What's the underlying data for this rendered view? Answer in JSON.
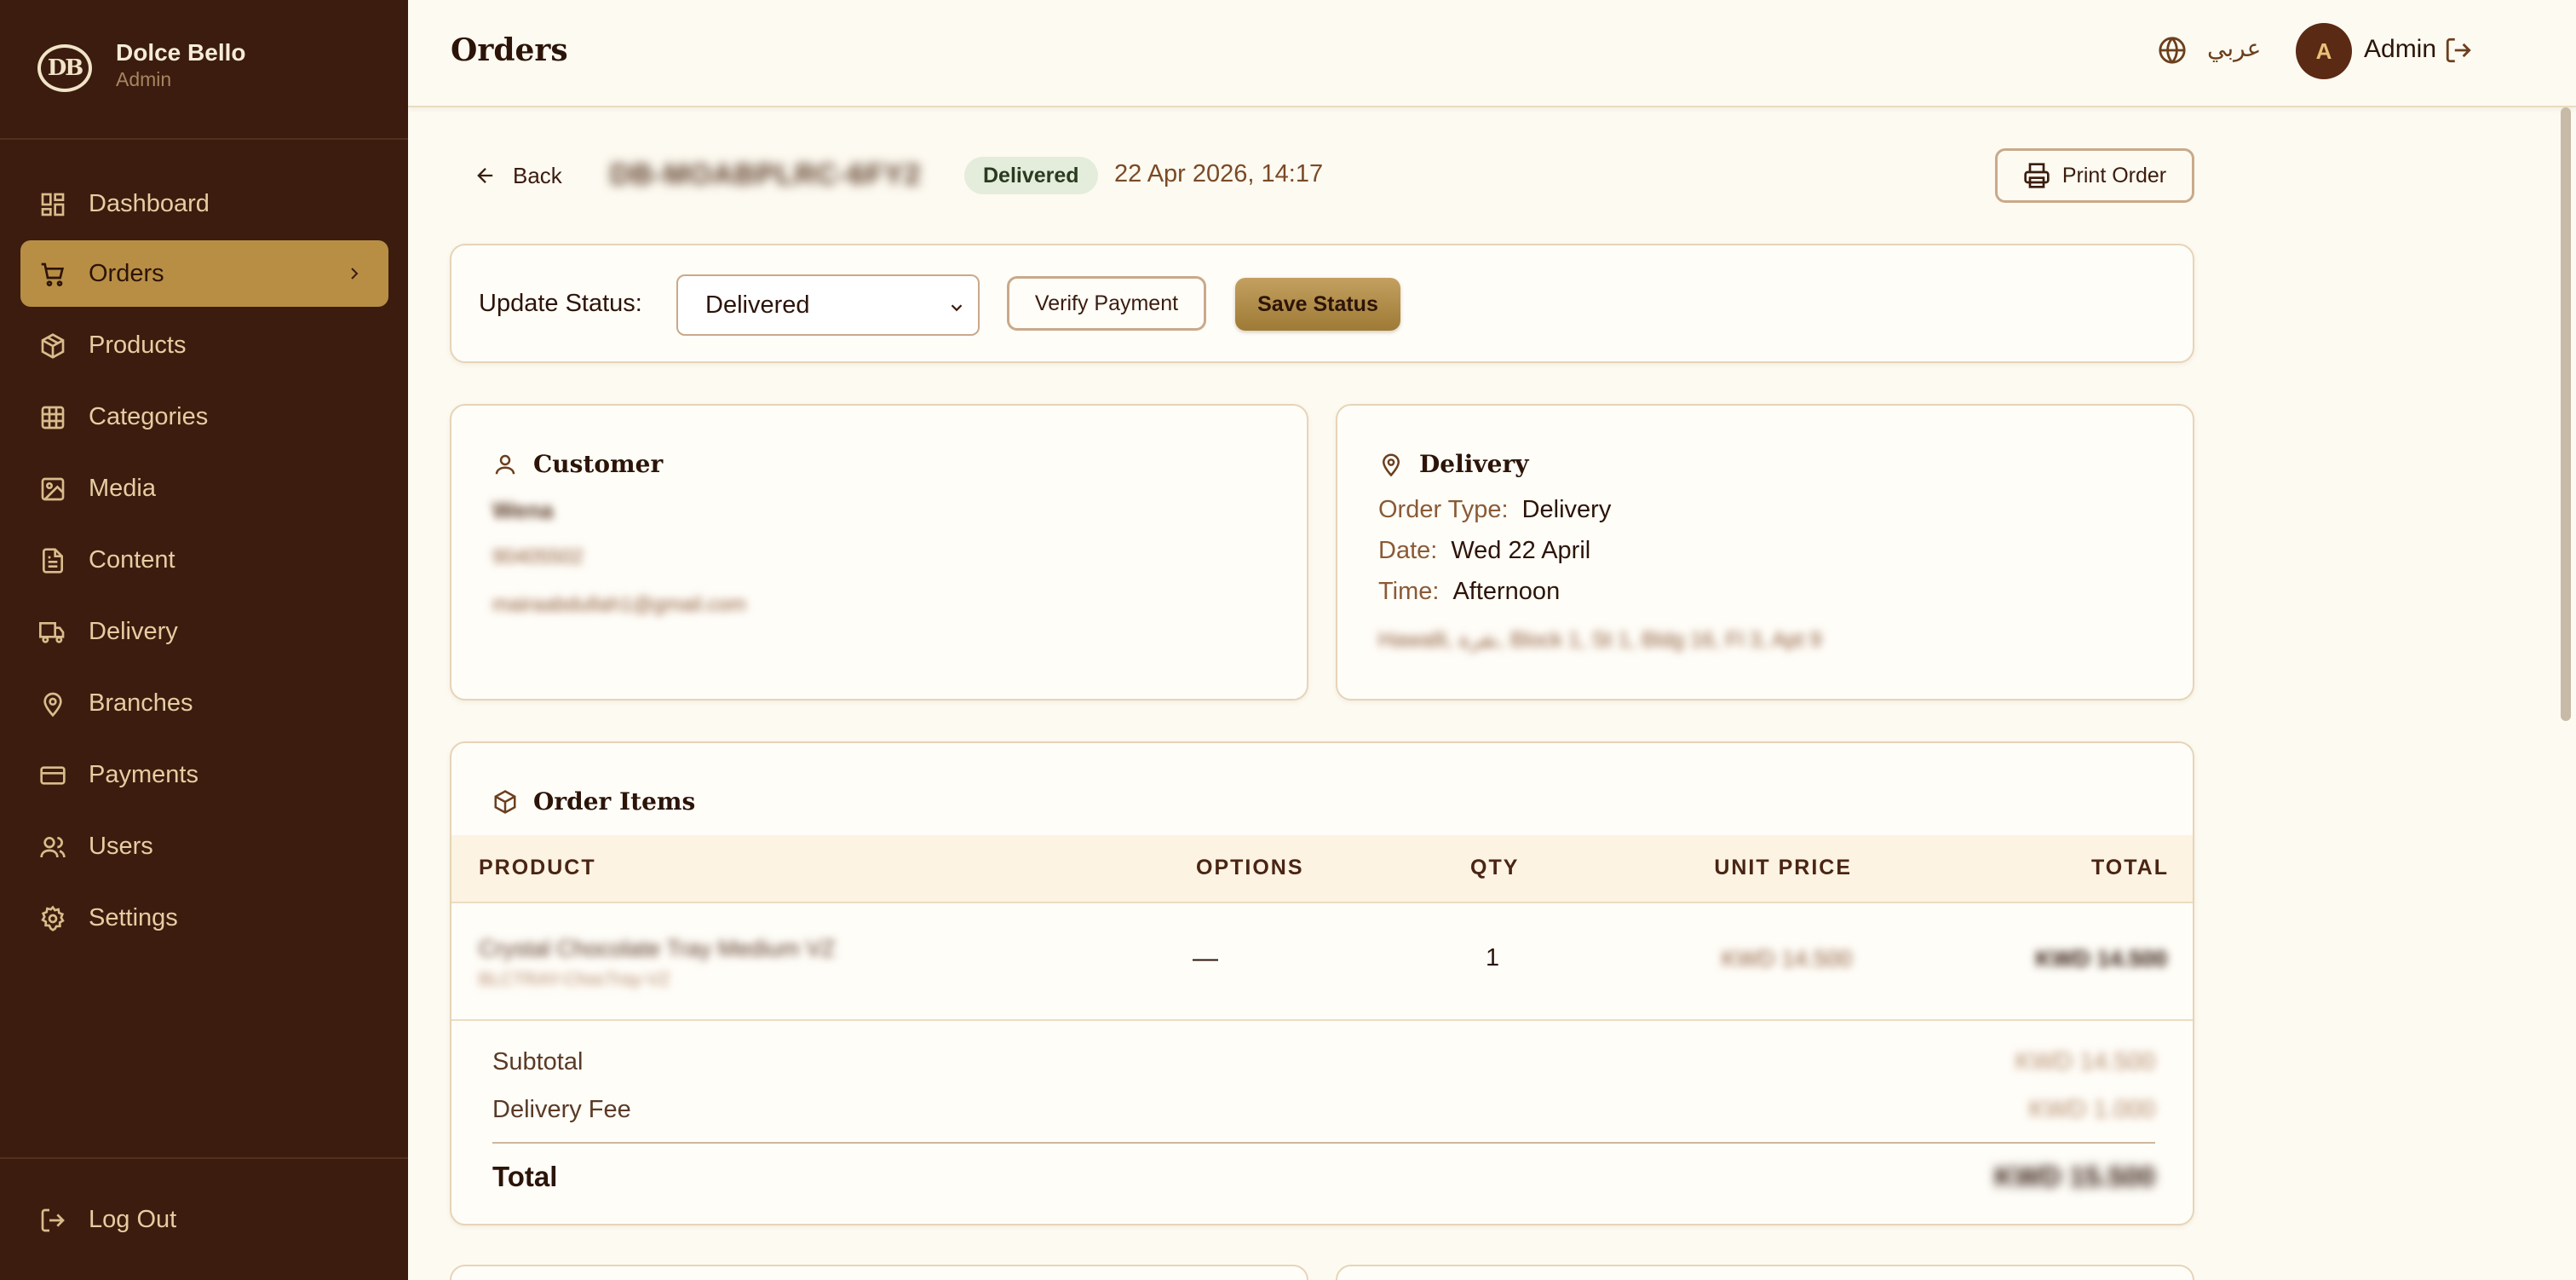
{
  "brand": {
    "name": "Dolce Bello",
    "role": "Admin",
    "logo_text": "DB"
  },
  "sidebar": {
    "items": [
      {
        "label": "Dashboard",
        "icon": "dashboard-icon"
      },
      {
        "label": "Orders",
        "icon": "cart-icon",
        "active": true
      },
      {
        "label": "Products",
        "icon": "box-icon"
      },
      {
        "label": "Categories",
        "icon": "grid-icon"
      },
      {
        "label": "Media",
        "icon": "image-icon"
      },
      {
        "label": "Content",
        "icon": "document-icon"
      },
      {
        "label": "Delivery",
        "icon": "truck-icon"
      },
      {
        "label": "Branches",
        "icon": "map-pin-icon"
      },
      {
        "label": "Payments",
        "icon": "credit-card-icon"
      },
      {
        "label": "Users",
        "icon": "users-icon"
      },
      {
        "label": "Settings",
        "icon": "gear-icon"
      }
    ],
    "logout_label": "Log Out"
  },
  "header": {
    "title": "Orders",
    "language": "عربي",
    "user_initial": "A",
    "user_name": "Admin"
  },
  "order": {
    "back_label": "Back",
    "id": "DB-MOABPLRC-6FY2",
    "status_badge": "Delivered",
    "datetime": "22 Apr 2026, 14:17",
    "print_label": "Print Order"
  },
  "status_panel": {
    "label": "Update Status:",
    "selected": "Delivered",
    "verify_label": "Verify Payment",
    "save_label": "Save Status"
  },
  "customer": {
    "title": "Customer",
    "name": "Wena",
    "phone": "90405502",
    "email": "mairaabdullah1@gmail.com"
  },
  "delivery": {
    "title": "Delivery",
    "order_type_label": "Order Type:",
    "order_type": "Delivery",
    "date_label": "Date:",
    "date": "Wed 22 April",
    "time_label": "Time:",
    "time": "Afternoon",
    "address": "Hawalli, نقرة, Block 1, St 1, Bldg 16, Fl 3, Apt 9"
  },
  "items": {
    "title": "Order Items",
    "columns": [
      "PRODUCT",
      "OPTIONS",
      "QTY",
      "UNIT PRICE",
      "TOTAL"
    ],
    "rows": [
      {
        "product": "Crystal Chocolate Tray Medium VZ",
        "sku": "BLCTRAY-ChocTray-VZ",
        "options": "—",
        "qty": "1",
        "unit_price": "KWD 14.500",
        "total": "KWD 14.500"
      }
    ],
    "subtotal_label": "Subtotal",
    "subtotal": "KWD 14.500",
    "delivery_fee_label": "Delivery Fee",
    "delivery_fee": "KWD 1.000",
    "total_label": "Total",
    "total": "KWD 15.500"
  },
  "colors": {
    "sidebar_bg": "#3b1c0e",
    "accent": "#b88e45",
    "page_bg": "#fdfaf1",
    "badge_bg": "#e4ecdb"
  }
}
